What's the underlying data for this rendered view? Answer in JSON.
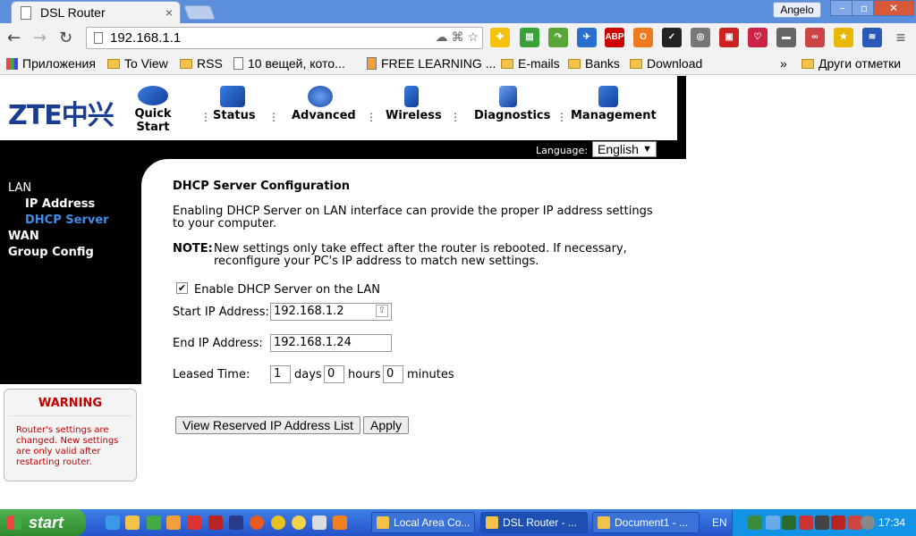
{
  "browser": {
    "tab_title": "DSL Router",
    "tab_close": "×",
    "user_name": "Angelo",
    "win_min": "–",
    "win_max": "▫",
    "win_close": "✕",
    "url": "192.168.1.1",
    "back": "←",
    "forward": "→",
    "reload": "↻",
    "star": "☆"
  },
  "extensions": [
    {
      "name": "puzzle-extension-icon",
      "color": "#f4c20d",
      "label": "✚"
    },
    {
      "name": "printer-extension-icon",
      "color": "#3aa03a",
      "label": "▤"
    },
    {
      "name": "arrow-extension-icon",
      "color": "#5aa53a",
      "label": "↷"
    },
    {
      "name": "bird-extension-icon",
      "color": "#2a6fd0",
      "label": "✈"
    },
    {
      "name": "adblock-icon",
      "color": "#d00000",
      "label": "ABP"
    },
    {
      "name": "o-extension-icon",
      "color": "#f07a20",
      "label": "O"
    },
    {
      "name": "check-extension-icon",
      "color": "#222222",
      "label": "✓"
    },
    {
      "name": "film-extension-icon",
      "color": "#777777",
      "label": "◎"
    },
    {
      "name": "save-extension-icon",
      "color": "#cc2222",
      "label": "▣"
    },
    {
      "name": "heart-extension-icon",
      "color": "#cc2244",
      "label": "♡"
    },
    {
      "name": "folder-extension-icon",
      "color": "#666666",
      "label": "▬"
    },
    {
      "name": "chain-extension-icon",
      "color": "#cc4444",
      "label": "∞"
    },
    {
      "name": "star-extension-icon",
      "color": "#e8b800",
      "label": "★"
    },
    {
      "name": "rss-extension-icon",
      "color": "#2a5ab8",
      "label": "≋"
    },
    {
      "name": "menu-icon",
      "color": "#666666",
      "label": "≡"
    }
  ],
  "bookmarks": {
    "apps": "Приложения",
    "items": [
      "To View",
      "RSS",
      "10 вещей, кото...",
      "FREE LEARNING ...",
      "E-mails",
      "Banks",
      "Download"
    ],
    "more": "»",
    "other": "Други отметки"
  },
  "router": {
    "logo": "ZTE中兴",
    "nav": [
      "Quick Start",
      "Status",
      "Advanced",
      "Wireless",
      "Diagnostics",
      "Management"
    ],
    "language_label": "Language:",
    "language_value": "English",
    "sidebar": {
      "lan": "LAN",
      "ip_address": "IP Address",
      "dhcp_server": "DHCP Server",
      "wan": "WAN",
      "group_config": "Group Config"
    },
    "warning": {
      "title": "WARNING",
      "text": "Router's settings are changed. New settings are only valid after restarting router."
    },
    "content": {
      "title": "DHCP Server Configuration",
      "desc_line1": "Enabling DHCP Server on LAN interface can provide the proper IP address settings",
      "desc_line2": "to your computer.",
      "note_label": "NOTE:",
      "note_line1": "New settings only take effect after the router is rebooted. If necessary,",
      "note_line2": "reconfigure your PC's IP address to match new settings.",
      "enable_label": "Enable DHCP Server on the LAN",
      "enable_checked": "✔",
      "start_ip_label": "Start IP Address:",
      "start_ip_value": "192.168.1.2",
      "end_ip_label": "End IP Address:",
      "end_ip_value": "192.168.1.24",
      "lease_label": "Leased Time:",
      "days_value": "1",
      "days_label": "days",
      "hours_value": "0",
      "hours_label": "hours",
      "minutes_value": "0",
      "minutes_label": "minutes",
      "view_reserved_button": "View Reserved IP Address List",
      "apply_button": "Apply"
    }
  },
  "taskbar": {
    "start": "start",
    "tasks": [
      "Local Area Co...",
      "DSL Router - ...",
      "Document1 - ..."
    ],
    "lang": "EN",
    "clock": "17:34"
  }
}
